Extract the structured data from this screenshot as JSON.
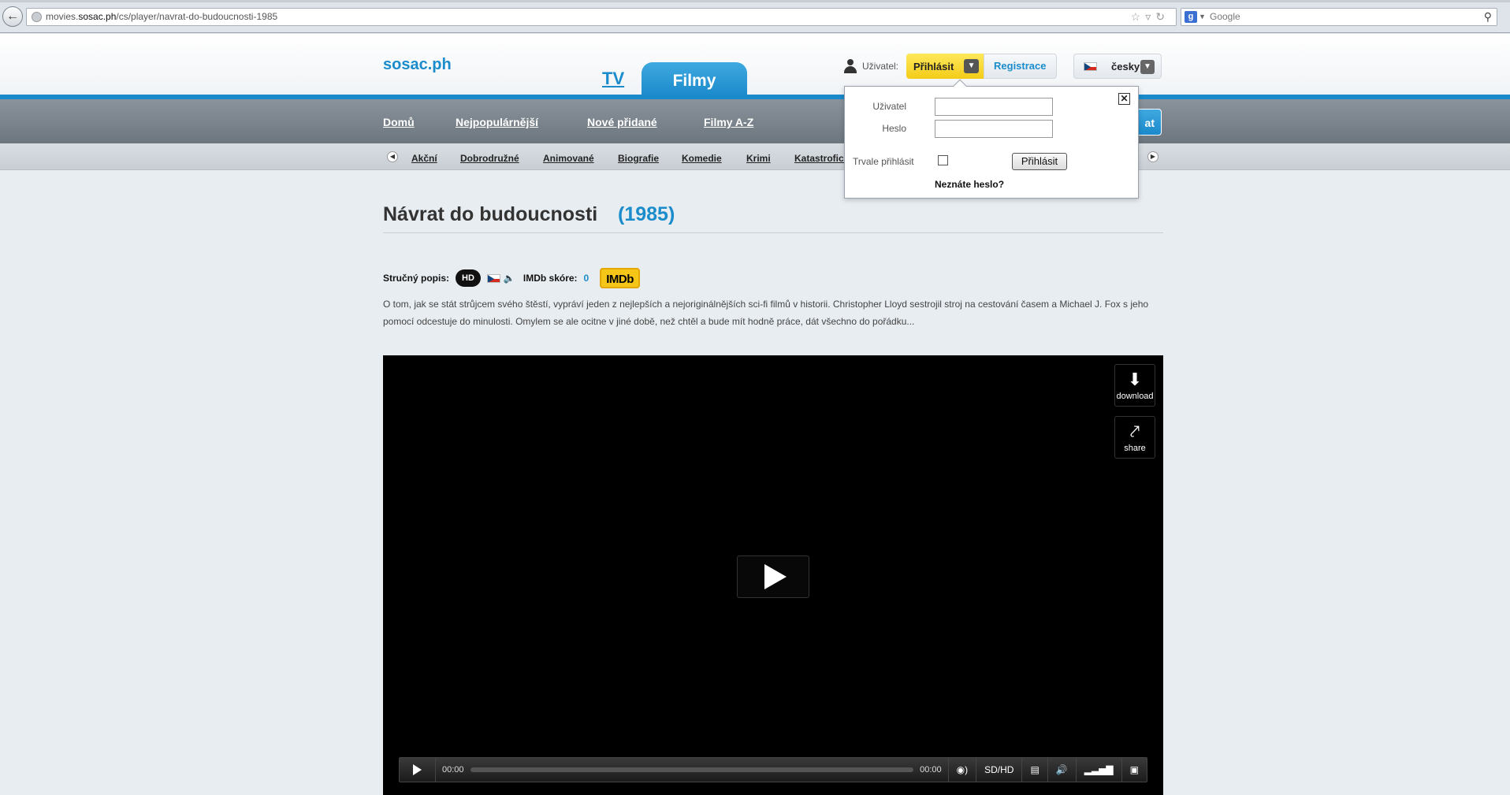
{
  "browser": {
    "url_prefix": "movies.",
    "url_host": "sosac.ph",
    "url_path": "/cs/player/navrat-do-budoucnosti-1985",
    "search_placeholder": "Google"
  },
  "header": {
    "logo": "sosac.ph",
    "tab_tv": "TV",
    "tab_filmy": "Filmy",
    "user_label": "Uživatel:",
    "login_button": "Přihlásit",
    "register_button": "Registrace",
    "language": "česky"
  },
  "nav": {
    "items": [
      "Domů",
      "Nejpopulárnější",
      "Nové přidané",
      "Filmy A-Z"
    ],
    "right_button_fragment": "at"
  },
  "genres": [
    "Akční",
    "Dobrodružné",
    "Animované",
    "Biografie",
    "Komedie",
    "Krimi",
    "Katastrofick"
  ],
  "movie": {
    "title": "Návrat do budoucnosti",
    "year": "(1985)",
    "short_desc_label": "Stručný popis:",
    "hd_badge": "HD",
    "imdb_label": "IMDb skóre:",
    "imdb_score": "0",
    "imdb_logo": "IMDb",
    "description": "O tom, jak se stát strůjcem svého štěstí, vypráví jeden z nejlepších a nejoriginálnějších sci-fi filmů v historii. Christopher Lloyd sestrojil stroj na cestování časem a Michael J. Fox s jeho pomocí odcestuje do minulosti. Omylem se ale ocitne v jiné době, než chtěl a bude mít hodně práce, dát všechno do pořádku..."
  },
  "player": {
    "download_label": "download",
    "share_label": "share",
    "time_current": "00:00",
    "time_total": "00:00",
    "quality_label": "SD/HD"
  },
  "login_popup": {
    "user_label": "Uživatel",
    "password_label": "Heslo",
    "remember_label": "Trvale přihlásit",
    "submit_label": "Přihlásit",
    "forgot_label": "Neznáte heslo?"
  }
}
